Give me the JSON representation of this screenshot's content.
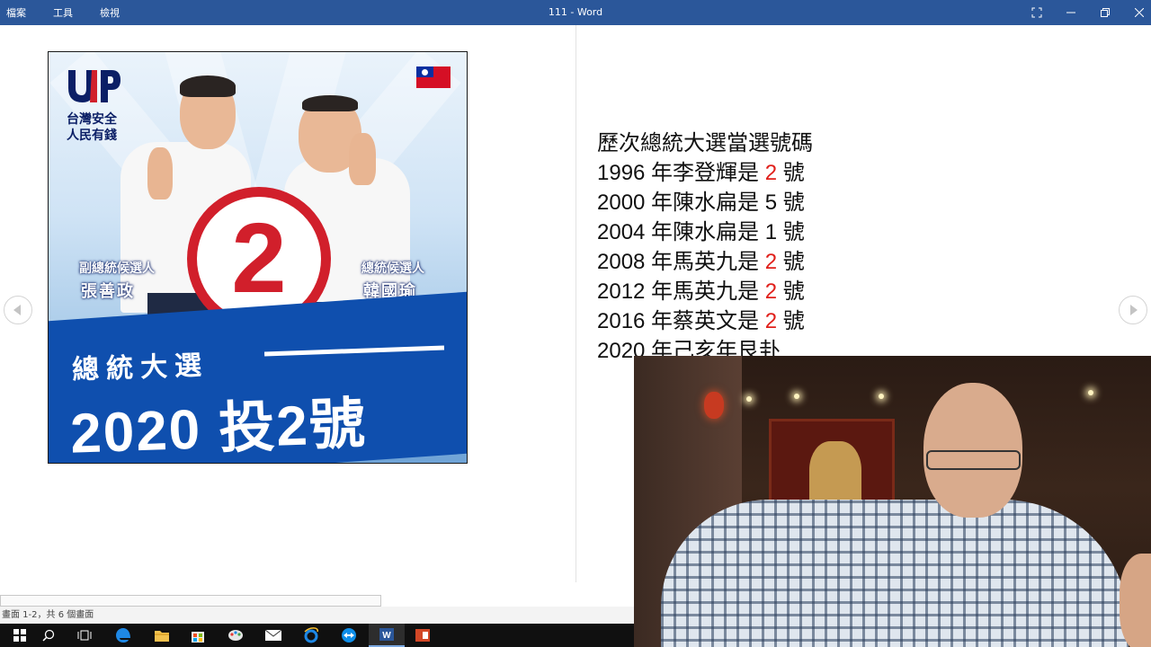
{
  "titlebar": {
    "menu": [
      "檔案",
      "工具",
      "檢視"
    ],
    "window_title": "111 - Word",
    "bg_color": "#2b579a"
  },
  "poster": {
    "party_line1": "台灣安全",
    "party_line2": "人民有錢",
    "number": "2",
    "vp_role": "副總統候選人",
    "vp_name": "張善政",
    "p_role": "總統候選人",
    "p_name": "韓國瑜",
    "band_title": "總統大選",
    "band_big": "2020 投2號",
    "accent_red": "#d11f2b",
    "band_blue": "#0f4fae"
  },
  "text": {
    "heading": "歷次總統大選當選號碼",
    "lines": [
      {
        "year": "1996",
        "mid": " 年李登輝是 ",
        "num": "2",
        "end": " 號",
        "num_red": true
      },
      {
        "year": "2000",
        "mid": " 年陳水扁是 ",
        "num": "5",
        "end": " 號",
        "num_red": false
      },
      {
        "year": "2004",
        "mid": " 年陳水扁是 ",
        "num": "1",
        "end": " 號",
        "num_red": false
      },
      {
        "year": "2008",
        "mid": " 年馬英九是 ",
        "num": "2",
        "end": " 號",
        "num_red": true
      },
      {
        "year": "2012",
        "mid": " 年馬英九是 ",
        "num": "2",
        "end": " 號",
        "num_red": true
      },
      {
        "year": "2016",
        "mid": " 年蔡英文是 ",
        "num": "2",
        "end": " 號",
        "num_red": true
      }
    ],
    "last_line": "2020 年己亥年艮卦"
  },
  "status": {
    "page_info": "畫面 1-2，共 6 個畫面"
  },
  "taskbar": {
    "icons": [
      "windows-start-icon",
      "search-icon",
      "task-view-icon",
      "edge-icon",
      "file-explorer-icon",
      "store-icon",
      "paint-icon",
      "mail-icon",
      "internet-explorer-icon",
      "teamviewer-icon",
      "word-icon",
      "powerpoint-icon"
    ]
  }
}
